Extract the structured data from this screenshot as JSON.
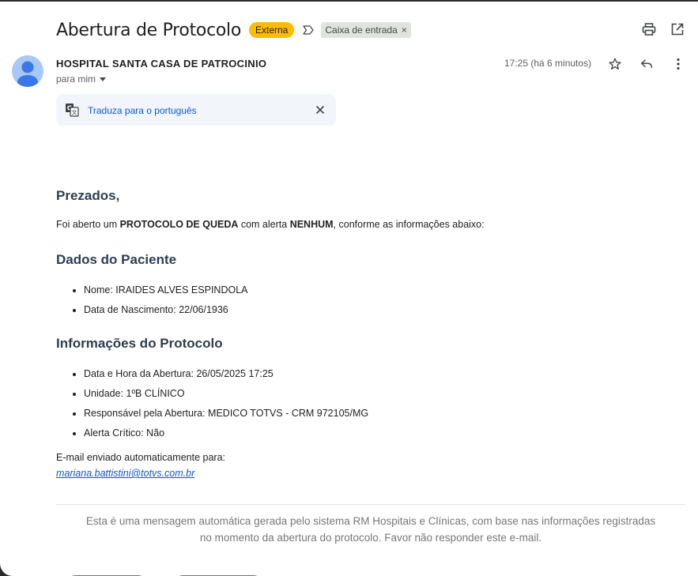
{
  "email": {
    "subject": "Abertura de Protocolo",
    "external_badge": "Externa",
    "label_chip": "Caixa de entrada",
    "chip_close": "×"
  },
  "icons": {
    "print": "printer-icon",
    "popout": "open-in-new-window-icon",
    "star": "star-icon",
    "reply": "reply-icon",
    "more": "more-vert-icon",
    "translate": "translate-icon",
    "close": "close-icon",
    "label": "label-important-icon"
  },
  "header": {
    "sender": "HOSPITAL SANTA CASA DE PATROCINIO",
    "recipient": "para mim",
    "time": "17:25 (há 6 minutos)"
  },
  "translate": {
    "link": "Traduza para o português"
  },
  "message": {
    "greeting": "Prezados,",
    "intro": {
      "part1": "Foi aberto um ",
      "bold1": "PROTOCOLO DE QUEDA",
      "part2": " com alerta ",
      "bold2": "NENHUM",
      "part3": ", conforme as informações abaixo:"
    },
    "patient_heading": "Dados do Paciente",
    "patient_items": [
      "Nome: IRAIDES ALVES ESPINDOLA",
      "Data de Nascimento: 22/06/1936"
    ],
    "protocol_heading": "Informações do Protocolo",
    "protocol_items": [
      "Data e Hora da Abertura: 26/05/2025 17:25",
      "Unidade: 1ºB CLÍNICO",
      "Responsável pela Abertura: MEDICO TOTVS - CRM 972105/MG",
      "Alerta Crítico: Não"
    ],
    "auto_sent_label": "E-mail enviado automaticamente para:",
    "auto_sent_email": "mariana.battistini@totvs.com.br",
    "footer_line1": "Esta é uma mensagem automática gerada pelo sistema RM Hospitais e Clínicas, com base nas informações registradas",
    "footer_line2": "no momento da abertura do protocolo. Favor não responder este e-mail."
  },
  "colors": {
    "external_badge": "#fbbc04",
    "link": "#1155cc",
    "heading": "#2c3e50",
    "avatar": "#a8c7fa"
  }
}
